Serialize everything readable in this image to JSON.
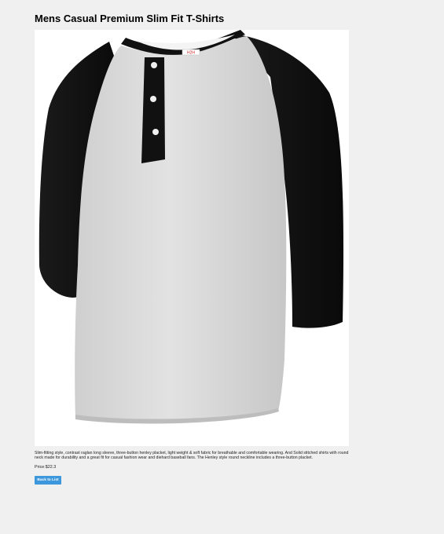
{
  "product": {
    "title": "Mens Casual Premium Slim Fit T-Shirts",
    "image_icon": "henley-shirt-image",
    "image_brand_tag": "H2H",
    "description": "Slim-fitting style, contrast raglan long sleeve, three-button henley placket, light weight & soft fabric for breathable and comfortable wearing. And Solid stitched shirts with round neck made for durability and a great fit for casual fashion wear and diehard baseball fans. The Henley style round neckline includes a three-button placket.",
    "price_label": "Price:",
    "price_value": "$22.3"
  },
  "actions": {
    "back_label": "Back to List"
  },
  "colors": {
    "background": "#f0f0f0",
    "button": "#3d97dd",
    "shirt_body": "#d9d9d9",
    "shirt_sleeves": "#111111"
  }
}
